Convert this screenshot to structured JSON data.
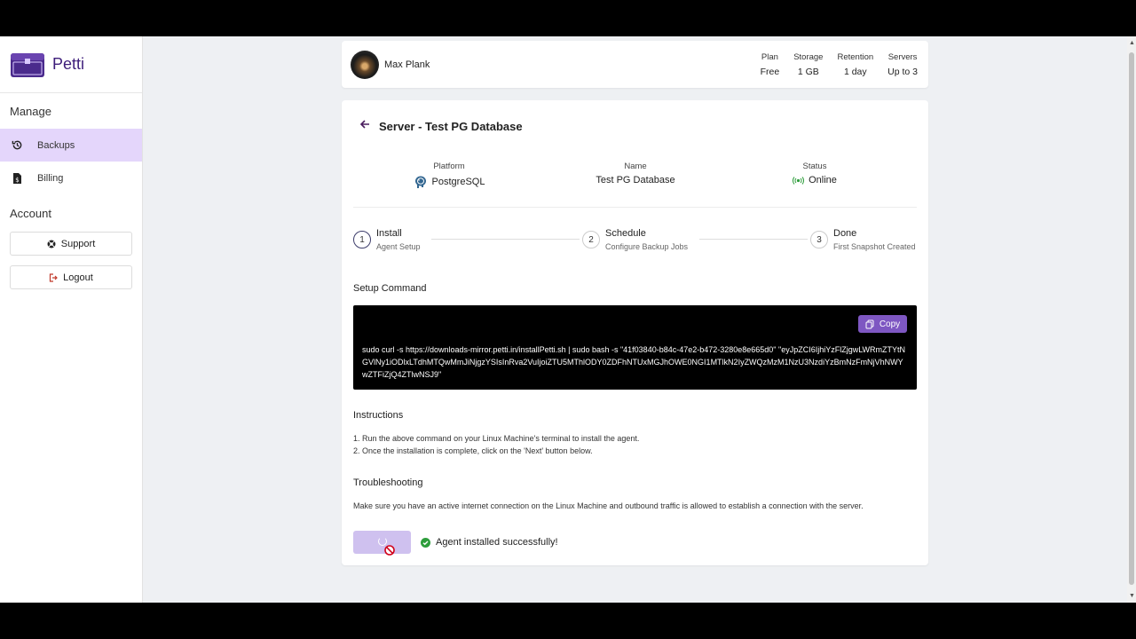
{
  "brand": {
    "name": "Petti",
    "color": "#4a2a8c"
  },
  "sidebar": {
    "sections": [
      {
        "title": "Manage"
      },
      {
        "title": "Account"
      }
    ],
    "items": [
      {
        "label": "Backups",
        "icon": "history-icon",
        "active": true
      },
      {
        "label": "Billing",
        "icon": "invoice-icon",
        "active": false
      }
    ],
    "buttons": [
      {
        "label": "Support",
        "icon": "support-icon"
      },
      {
        "label": "Logout",
        "icon": "logout-icon"
      }
    ]
  },
  "user": {
    "name": "Max Plank"
  },
  "plan": [
    {
      "label": "Plan",
      "value": "Free"
    },
    {
      "label": "Storage",
      "value": "1 GB"
    },
    {
      "label": "Retention",
      "value": "1 day"
    },
    {
      "label": "Servers",
      "value": "Up to 3"
    }
  ],
  "server": {
    "title": "Server - Test PG Database",
    "info": [
      {
        "label": "Platform",
        "value": "PostgreSQL",
        "icon": "postgresql-icon"
      },
      {
        "label": "Name",
        "value": "Test PG Database"
      },
      {
        "label": "Status",
        "value": "Online",
        "icon": "online-icon"
      }
    ]
  },
  "steps": [
    {
      "num": "1",
      "title": "Install",
      "subtitle": "Agent Setup",
      "active": true
    },
    {
      "num": "2",
      "title": "Schedule",
      "subtitle": "Configure Backup Jobs",
      "active": false
    },
    {
      "num": "3",
      "title": "Done",
      "subtitle": "First Snapshot Created",
      "active": false
    }
  ],
  "setup": {
    "title": "Setup Command",
    "copy_label": "Copy",
    "command": "sudo curl -s https://downloads-mirror.petti.in/installPetti.sh | sudo bash -s \"41f03840-b84c-47e2-b472-3280e8e665d0\" \"eyJpZCI6IjhiYzFlZjgwLWRmZTYtNGVlNy1iODlxLTdhMTQwMmJiNjgzYSIsInRva2VuIjoiZTU5MThlODY0ZDFhNTUxMGJhOWE0NGI1MTlkN2IyZWQzMzM1NzU3NzdiYzBmNzFmNjVhNWYwZTFiZjQ4ZTlwNSJ9\""
  },
  "instructions": {
    "title": "Instructions",
    "lines": [
      "1. Run the above command on your Linux Machine's terminal to install the agent.",
      "2. Once the installation is complete, click on the 'Next' button below."
    ]
  },
  "troubleshooting": {
    "title": "Troubleshooting",
    "text": "Make sure you have an active internet connection on the Linux Machine and outbound traffic is allowed to establish a connection with the server."
  },
  "status_message": "Agent installed successfully!",
  "colors": {
    "accent": "#7e57c2",
    "active_nav": "#e4d6fb",
    "success": "#2e9d3c",
    "online": "#2e9d3c"
  }
}
